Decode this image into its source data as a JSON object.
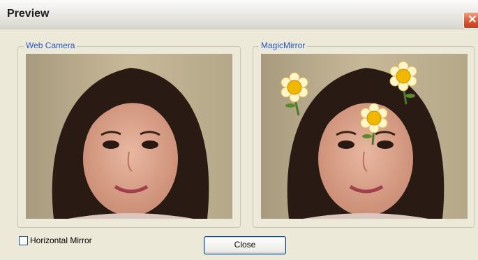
{
  "window": {
    "title": "Preview",
    "close_glyph": "✕"
  },
  "groups": {
    "web_camera": {
      "label": "Web Camera"
    },
    "magic_mirror": {
      "label": "MagicMirror"
    }
  },
  "options": {
    "horizontal_mirror_label": "Horizontal Mirror",
    "horizontal_mirror_checked": false
  },
  "buttons": {
    "close_label": "Close"
  },
  "icons": [
    "close-icon",
    "flower-icon"
  ],
  "colors": {
    "accent_label": "#2155c4",
    "dialog_bg": "#ece9d8",
    "close_red": "#d8532f"
  }
}
